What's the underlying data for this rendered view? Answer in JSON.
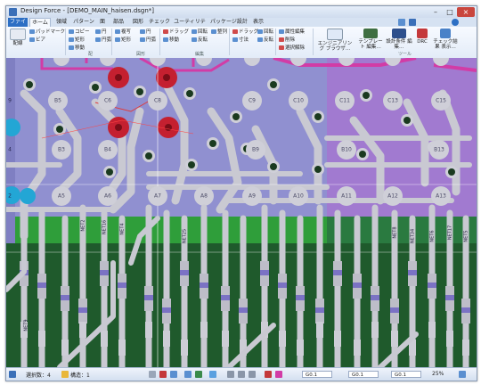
{
  "window": {
    "title": "Design Force - [DEMO_MAIN_haisen.dsgn*]",
    "controls": [
      "–",
      "□",
      "×"
    ]
  },
  "tabs": [
    {
      "label": "ファイル",
      "kind": "file"
    },
    {
      "label": "ホーム",
      "kind": "active"
    },
    {
      "label": "領域",
      "kind": "normal"
    },
    {
      "label": "パターン",
      "kind": "normal"
    },
    {
      "label": "面",
      "kind": "normal"
    },
    {
      "label": "部品",
      "kind": "normal"
    },
    {
      "label": "図形",
      "kind": "normal"
    },
    {
      "label": "チェック",
      "kind": "normal"
    },
    {
      "label": "ユーティリティ",
      "kind": "normal"
    },
    {
      "label": "パッケージ設計",
      "kind": "normal"
    },
    {
      "label": "表示",
      "kind": "normal"
    }
  ],
  "ribbon": {
    "haisen": "配線",
    "pad_mark": "パッドマーク",
    "via": "ビア",
    "copy": "コピー",
    "move_left": "移動",
    "rotate_left": "回転",
    "mirror": "鏡",
    "circle": "円",
    "rect": "矩形",
    "arc": "円弧",
    "copy2": "複写",
    "move2": "移動",
    "bend": "ドラッグ",
    "bend2": "ドラッグ",
    "rotate": "回転",
    "reverse": "反転",
    "align": "整列",
    "dimension": "寸法",
    "delete": "削除",
    "select_all": "選択解除",
    "attr_edit": "属性編集",
    "constraint": "エンジニアリング ブラウザ…",
    "template": "テンプレート 編集…",
    "setting": "設計条件 編集…",
    "drc": "DRC",
    "check_result": "チェック結果 表示…",
    "group_labels": [
      "配",
      "図形",
      "編集",
      "ツール"
    ]
  },
  "board": {
    "row_top": [
      "B5",
      "C6",
      "C8",
      "C9",
      "C10",
      "C11",
      "C13",
      "C15"
    ],
    "row_b": [
      "B3",
      "B4",
      "B9",
      "B10",
      "B13"
    ],
    "row_a": [
      "A5",
      "A6",
      "A7",
      "A8",
      "A9",
      "A10",
      "A11",
      "A12",
      "A13"
    ],
    "left_edge": [
      "9",
      "4",
      "2"
    ],
    "net_labels": [
      "NET2",
      "NET16",
      "NET4",
      "NET25",
      "NET8",
      "NET34",
      "NET6",
      "NET17",
      "NET5",
      "NET9"
    ]
  },
  "status": {
    "select_count": "選択数：4",
    "ref_count": "構造：1",
    "grid1": "G0.1",
    "grid2": "G0.1",
    "zoom_label": "G0.1",
    "percent": "25%"
  },
  "colors": {
    "board_lavender": "#9090d0",
    "board_purple": "#a17ad0",
    "green_plane": "#2f9e3a",
    "dark_green": "#1f5a2c",
    "trace": "#c9c9d2",
    "pad": "#cfcfd8",
    "red_pad": "#c42030",
    "magenta": "#d23ca6",
    "cyan": "#23a6d5"
  }
}
